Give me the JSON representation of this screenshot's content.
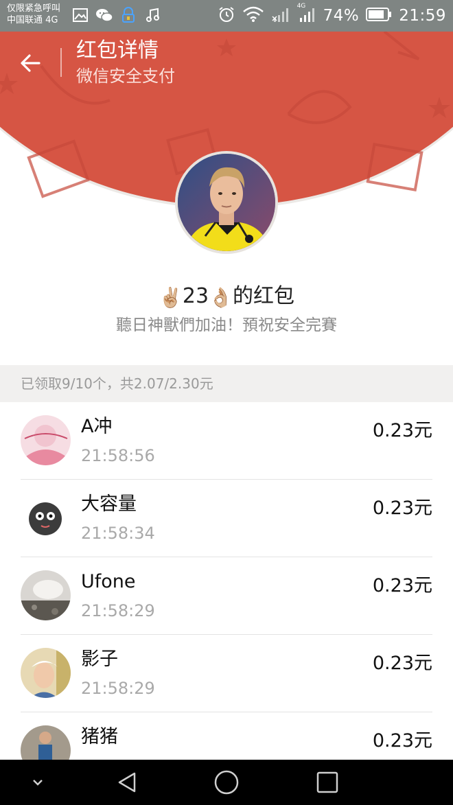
{
  "status_bar": {
    "carrier_line1": "仅限紧急呼叫",
    "carrier_line2": "中国联通 4G",
    "network_small": "4G",
    "battery": "74%",
    "time": "21:59",
    "icons": [
      "image-icon",
      "wechat-icon",
      "vpn-lock-icon",
      "music-icon",
      "alarm-icon",
      "wifi-icon",
      "signal-icon",
      "battery-icon"
    ]
  },
  "header": {
    "title": "红包详情",
    "subtitle": "微信安全支付",
    "back_icon": "arrow-left-icon",
    "background_color": "#d65544"
  },
  "sender": {
    "emoji_left": "✌🏼",
    "name": "23",
    "emoji_right": "👌🏼",
    "suffix": "的红包",
    "greeting": "聽日神獸們加油！預祝安全完賽"
  },
  "summary": {
    "text": "已领取9/10个，共2.07/2.30元"
  },
  "recipients": [
    {
      "name": "A冲",
      "time": "21:58:56",
      "amount": "0.23元"
    },
    {
      "name": "大容量",
      "time": "21:58:34",
      "amount": "0.23元"
    },
    {
      "name": "Ufone",
      "time": "21:58:29",
      "amount": "0.23元"
    },
    {
      "name": "影子",
      "time": "21:58:29",
      "amount": "0.23元"
    },
    {
      "name": "猪猪",
      "time": "",
      "amount": "0.23元"
    }
  ],
  "nav_bar": {
    "icons": [
      "collapse-icon",
      "back-triangle-icon",
      "home-circle-icon",
      "recents-square-icon"
    ]
  }
}
